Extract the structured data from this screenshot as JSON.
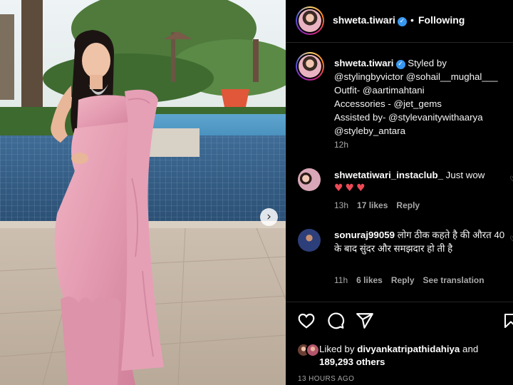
{
  "header": {
    "username": "shweta.tiwari",
    "verified_mark": "✓",
    "separator": "•",
    "follow_status": "Following"
  },
  "caption": {
    "username": "shweta.tiwari",
    "lines": [
      "Styled by",
      "@stylingbyvictor @sohail__mughal___",
      "Outfit- @aartimahtani",
      "Accessories - @jet_gems",
      "Assisted by- @stylevanitywithaarya",
      "@styleby_antara"
    ],
    "time": "12h"
  },
  "comments": [
    {
      "username": "shwetatiwari_instaclub_",
      "text": "Just wow",
      "emoji": "♥♥♥",
      "time": "13h",
      "likes": "17 likes",
      "reply": "Reply"
    },
    {
      "username": "sonuraj99059",
      "text": "लोग ठीक कहते है की औरत 40 के बाद सुंदर और समझदार हो ती है",
      "time": "11h",
      "likes": "6 likes",
      "reply": "Reply",
      "translate": "See translation"
    }
  ],
  "actions": {
    "icons": [
      "heart-icon",
      "comment-icon",
      "share-icon",
      "bookmark-icon"
    ]
  },
  "likes": {
    "prefix": "Liked by",
    "liked_by_user": "divyankatripathidahiya",
    "and": "and",
    "others_count": "189,293 others"
  },
  "post_time": "13 HOURS AGO",
  "carousel": {
    "next_glyph": "›"
  },
  "colors": {
    "background": "#000000",
    "verified": "#3897f0",
    "heart_red": "#ed4956",
    "muted_text": "#a8a8a8",
    "saree_pink": "#e59bb1"
  }
}
